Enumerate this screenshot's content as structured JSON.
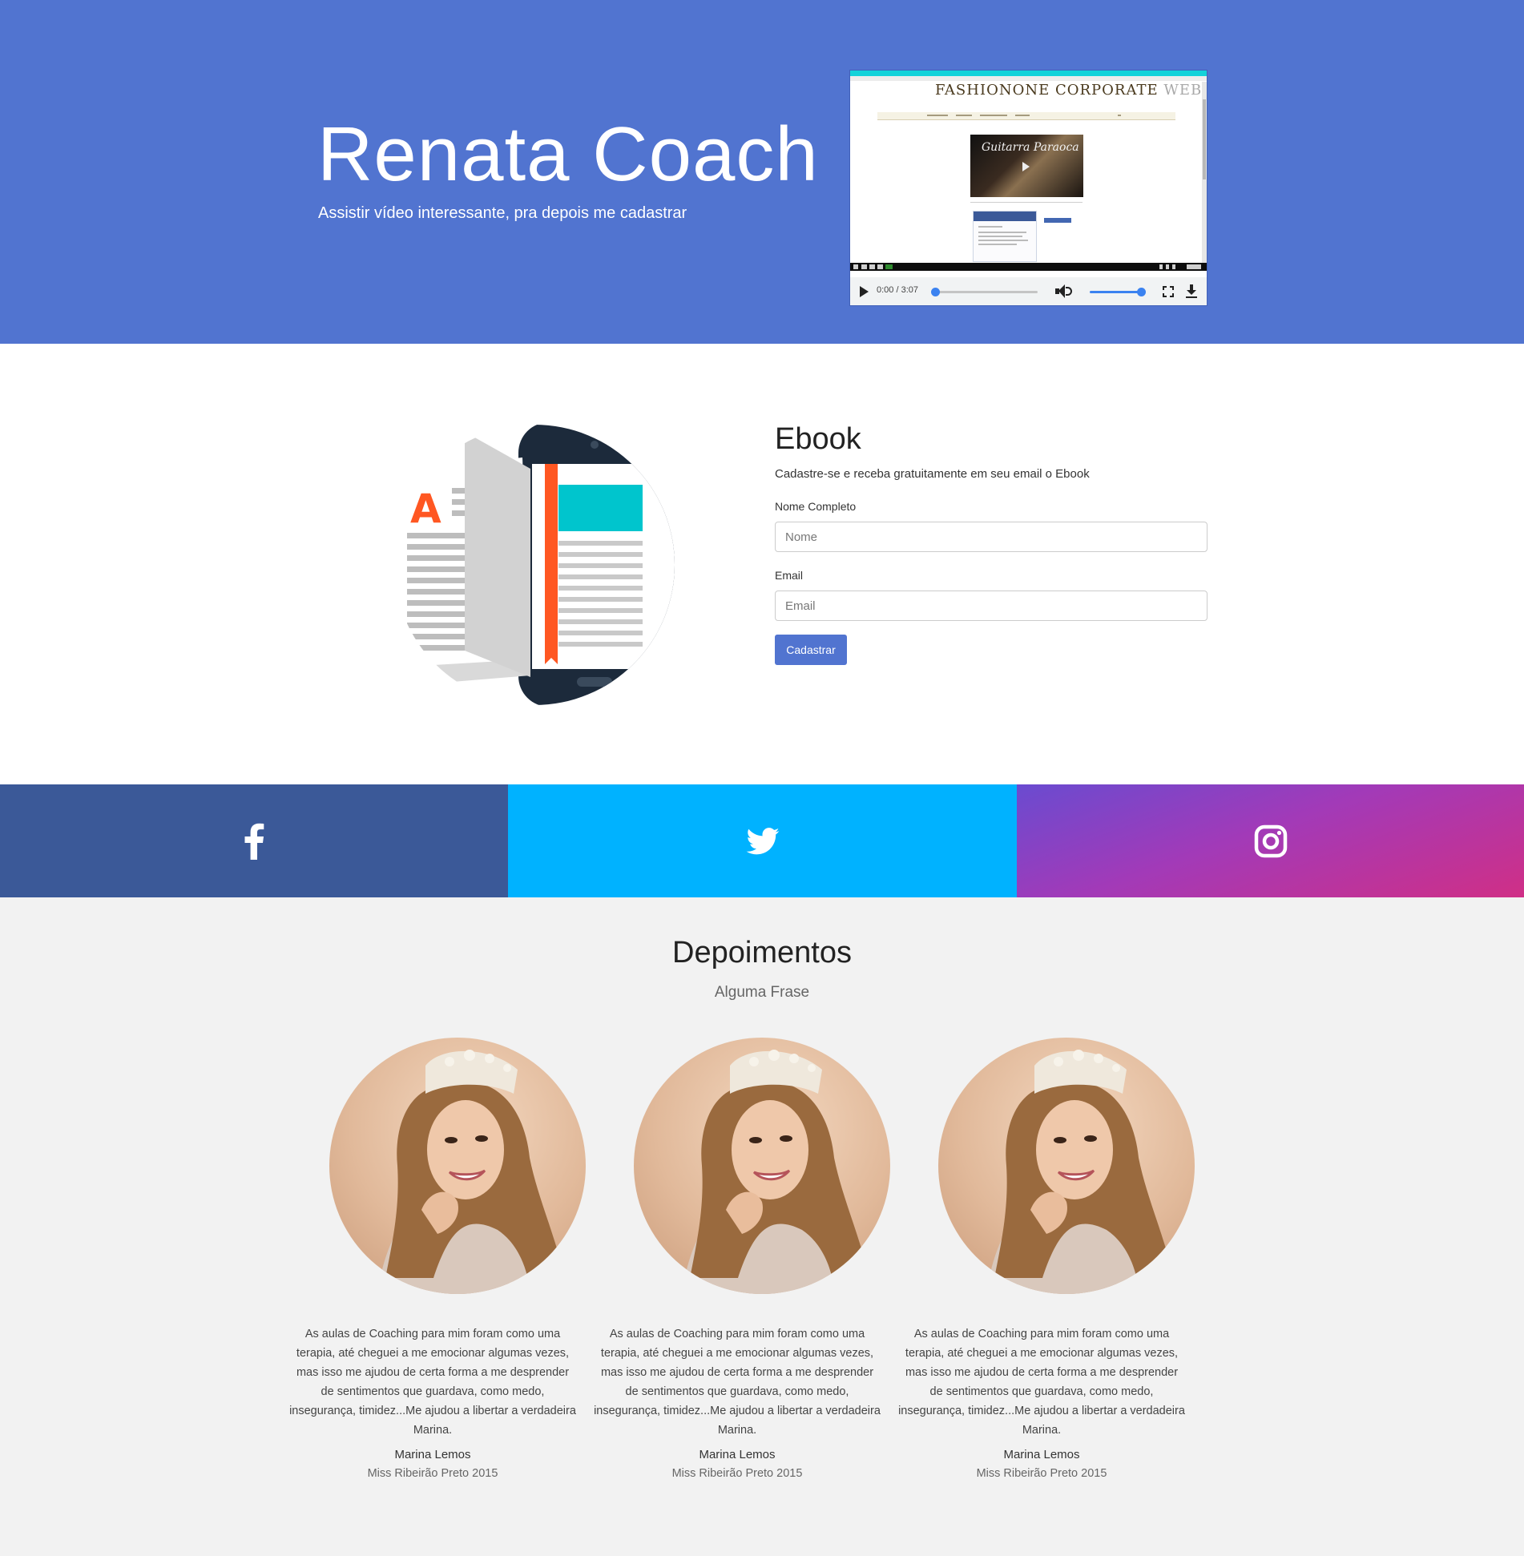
{
  "hero": {
    "title": "Renata Coach",
    "subtitle": "Assistir vídeo interessante, pra depois me cadastrar",
    "background": "#5174d0",
    "video": {
      "brand_dark": "FASHIONONE CORPORATE",
      "brand_light": " WEBSITE",
      "thumbnail_title": "Guitarra Paraoca",
      "time": "0:00 / 3:07",
      "progress": 0.0,
      "volume": 1.0
    }
  },
  "ebook": {
    "title": "Ebook",
    "subtitle": "Cadastre-se e receba gratuitamente em seu email o Ebook",
    "name_label": "Nome Completo",
    "name_placeholder": "Nome",
    "email_label": "Email",
    "email_placeholder": "Email",
    "submit_label": "Cadastrar",
    "illustration_letter": "A",
    "accent": "#5174d0"
  },
  "social": {
    "items": [
      {
        "name": "facebook",
        "icon": "facebook-icon",
        "color": "#3b5998"
      },
      {
        "name": "twitter",
        "icon": "twitter-icon",
        "color": "#00b2ff"
      },
      {
        "name": "instagram",
        "icon": "instagram-icon",
        "color": "#c13584"
      }
    ]
  },
  "testimonials": {
    "title": "Depoimentos",
    "subtitle": "Alguma Frase",
    "items": [
      {
        "quote": "As aulas de Coaching para mim foram como uma terapia, até cheguei a me emocionar algumas vezes, mas isso me ajudou de certa forma a me desprender de sentimentos que guardava, como medo, insegurança, timidez...Me ajudou a libertar a verdadeira Marina.",
        "name": "Marina Lemos",
        "role": "Miss Ribeirão Preto 2015"
      },
      {
        "quote": "As aulas de Coaching para mim foram como uma terapia, até cheguei a me emocionar algumas vezes, mas isso me ajudou de certa forma a me desprender de sentimentos que guardava, como medo, insegurança, timidez...Me ajudou a libertar a verdadeira Marina.",
        "name": "Marina Lemos",
        "role": "Miss Ribeirão Preto 2015"
      },
      {
        "quote": "As aulas de Coaching para mim foram como uma terapia, até cheguei a me emocionar algumas vezes, mas isso me ajudou de certa forma a me desprender de sentimentos que guardava, como medo, insegurança, timidez...Me ajudou a libertar a verdadeira Marina.",
        "name": "Marina Lemos",
        "role": "Miss Ribeirão Preto 2015"
      }
    ]
  }
}
